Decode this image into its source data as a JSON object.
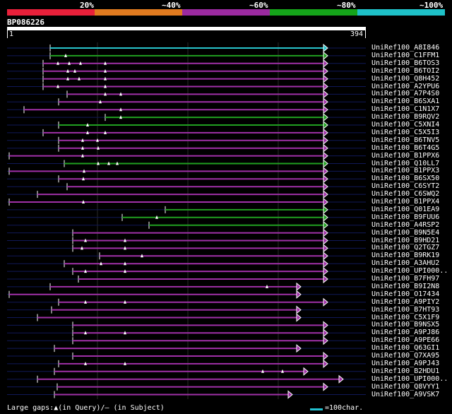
{
  "legend": {
    "labels": [
      "20%",
      "~40%",
      "~60%",
      "~80%",
      "~100%"
    ],
    "colors": [
      "#e8203a",
      "#e07a1f",
      "#9b2aa0",
      "#15a41a",
      "#1ec1c8"
    ]
  },
  "query": {
    "id": "BP086226",
    "start": "1",
    "end": "394"
  },
  "colors": {
    "cyan": "#28c4cc",
    "green": "#20a020",
    "purple": "#a030a8",
    "navy": "#101858",
    "grid": "#2a2a2a"
  },
  "hits": [
    {
      "name": "UniRef100_A8I846",
      "color": "cyan"
    },
    {
      "name": "UniRef100_C1FFM1",
      "color": "green"
    },
    {
      "name": "UniRef100_B6TOS3",
      "color": "purple"
    },
    {
      "name": "UniRef100_B6TOI2",
      "color": "purple"
    },
    {
      "name": "UniRef100_Q8H452",
      "color": "purple"
    },
    {
      "name": "UniRef100_A2YPU6",
      "color": "purple"
    },
    {
      "name": "UniRef100_A7P4S0",
      "color": "purple"
    },
    {
      "name": "UniRef100_B6SXA1",
      "color": "purple"
    },
    {
      "name": "UniRef100_C1N1X7",
      "color": "purple"
    },
    {
      "name": "UniRef100_B9RQV2",
      "color": "green"
    },
    {
      "name": "UniRef100_C5XNI4",
      "color": "green"
    },
    {
      "name": "UniRef100_C5X5I3",
      "color": "purple"
    },
    {
      "name": "UniRef100_B6TNV5",
      "color": "purple"
    },
    {
      "name": "UniRef100_B6T4G5",
      "color": "purple"
    },
    {
      "name": "UniRef100_B1PPX6",
      "color": "purple"
    },
    {
      "name": "UniRef100_Q10LL7",
      "color": "green"
    },
    {
      "name": "UniRef100_B1PPX3",
      "color": "purple"
    },
    {
      "name": "UniRef100_B6SX50",
      "color": "purple"
    },
    {
      "name": "UniRef100_C6SYT2",
      "color": "purple"
    },
    {
      "name": "UniRef100_C6SWQ2",
      "color": "purple"
    },
    {
      "name": "UniRef100_B1PPX4",
      "color": "purple"
    },
    {
      "name": "UniRef100_Q01EA9",
      "color": "green"
    },
    {
      "name": "UniRef100_B9FUU6",
      "color": "green"
    },
    {
      "name": "UniRef100_A4RSP2",
      "color": "green"
    },
    {
      "name": "UniRef100_B9N5E4",
      "color": "purple"
    },
    {
      "name": "UniRef100_B9HD21",
      "color": "purple"
    },
    {
      "name": "UniRef100_Q2TGZ7",
      "color": "purple"
    },
    {
      "name": "UniRef100_B9RK19",
      "color": "purple"
    },
    {
      "name": "UniRef100_A3AHU2",
      "color": "purple"
    },
    {
      "name": "UniRef100_UPI000..",
      "color": "purple"
    },
    {
      "name": "UniRef100_B7FH97",
      "color": "purple"
    },
    {
      "name": "UniRef100_B9I2N8",
      "color": "purple"
    },
    {
      "name": "UniRef100_O17434",
      "color": "purple"
    },
    {
      "name": "UniRef100_A9PIY2",
      "color": "purple"
    },
    {
      "name": "UniRef100_B7HT93",
      "color": "purple"
    },
    {
      "name": "UniRef100_C5X1F9",
      "color": "purple"
    },
    {
      "name": "UniRef100_B9NSX5",
      "color": "purple"
    },
    {
      "name": "UniRef100_A9PJ86",
      "color": "purple"
    },
    {
      "name": "UniRef100_A9PE66",
      "color": "purple"
    },
    {
      "name": "UniRef100_Q63GI1",
      "color": "purple"
    },
    {
      "name": "UniRef100_Q7XA95",
      "color": "purple"
    },
    {
      "name": "UniRef100_A9PJ43",
      "color": "purple"
    },
    {
      "name": "UniRef100_B2HDU1",
      "color": "purple"
    },
    {
      "name": "UniRef100_UPI000..",
      "color": "purple"
    },
    {
      "name": "UniRef100_Q8VYY1",
      "color": "purple"
    },
    {
      "name": "UniRef100_A9VSK7",
      "color": "purple"
    }
  ],
  "footer": {
    "gaps_text": "Large gaps:▲(in Query)/— (in Subject)",
    "scale_text": "=100char."
  }
}
